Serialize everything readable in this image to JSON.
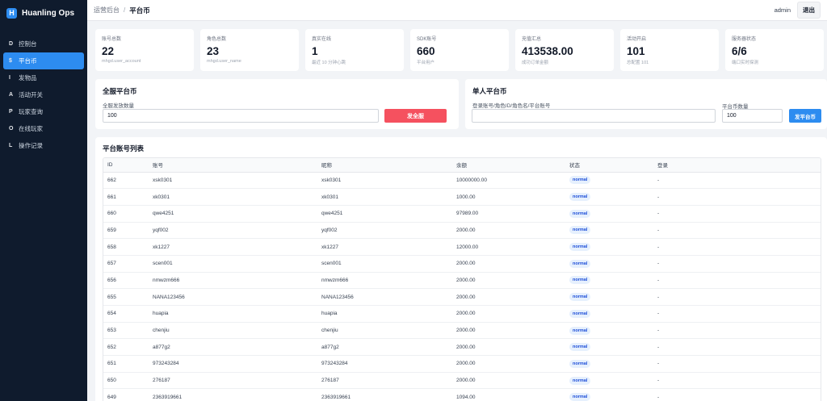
{
  "brand": {
    "logo": "H",
    "name": "Huanling Ops"
  },
  "sidebar": {
    "items": [
      {
        "key": "D",
        "label": "控制台"
      },
      {
        "key": "$",
        "label": "平台币",
        "active": true
      },
      {
        "key": "I",
        "label": "发物品"
      },
      {
        "key": "A",
        "label": "活动开关"
      },
      {
        "key": "P",
        "label": "玩家查询"
      },
      {
        "key": "O",
        "label": "在线玩家"
      },
      {
        "key": "L",
        "label": "操作记录"
      }
    ]
  },
  "header": {
    "crumb_root": "运营后台",
    "crumb_sep": "/",
    "crumb_current": "平台币",
    "user": "admin",
    "logout": "退出"
  },
  "stats": [
    {
      "label": "账号总数",
      "value": "22",
      "sub": "mhgd.user_account"
    },
    {
      "label": "角色总数",
      "value": "23",
      "sub": "mhgd.user_name"
    },
    {
      "label": "真实在线",
      "value": "1",
      "sub": "最近 10 分钟心跳"
    },
    {
      "label": "SDK账号",
      "value": "660",
      "sub": "平台用户"
    },
    {
      "label": "充值汇总",
      "value": "413538.00",
      "sub": "成功订单金额"
    },
    {
      "label": "活动开启",
      "value": "101",
      "sub": "总配置 101"
    },
    {
      "label": "服务器状态",
      "value": "6/6",
      "sub": "端口实时探测"
    }
  ],
  "all_coin": {
    "title": "全服平台币",
    "field_label": "全服发放数量",
    "amount": "100",
    "button": "发全服"
  },
  "single_coin": {
    "title": "单人平台币",
    "target_label": "登录账号/角色ID/角色名/平台账号",
    "target_value": "",
    "amount_label": "平台币数量",
    "amount": "100",
    "button": "发平台币"
  },
  "table": {
    "title": "平台账号列表",
    "columns": [
      "ID",
      "账号",
      "昵称",
      "余额",
      "状态",
      "登录"
    ],
    "rows": [
      [
        "662",
        "xsk0301",
        "xsk0301",
        "10000000.00",
        "normal",
        "-"
      ],
      [
        "661",
        "xk0301",
        "xk0301",
        "1000.00",
        "normal",
        "-"
      ],
      [
        "660",
        "qwe4251",
        "qwe4251",
        "97989.00",
        "normal",
        "-"
      ],
      [
        "659",
        "yqf002",
        "yqf002",
        "2000.00",
        "normal",
        "-"
      ],
      [
        "658",
        "xk1227",
        "xk1227",
        "12000.00",
        "normal",
        "-"
      ],
      [
        "657",
        "scen001",
        "scen001",
        "2000.00",
        "normal",
        "-"
      ],
      [
        "656",
        "nmwzm666",
        "nmwzm666",
        "2000.00",
        "normal",
        "-"
      ],
      [
        "655",
        "NANA123456",
        "NANA123456",
        "2000.00",
        "normal",
        "-"
      ],
      [
        "654",
        "huapia",
        "huapia",
        "2000.00",
        "normal",
        "-"
      ],
      [
        "653",
        "chenjiu",
        "chenjiu",
        "2000.00",
        "normal",
        "-"
      ],
      [
        "652",
        "a877g2",
        "a877g2",
        "2000.00",
        "normal",
        "-"
      ],
      [
        "651",
        "973243284",
        "973243284",
        "2000.00",
        "normal",
        "-"
      ],
      [
        "650",
        "276187",
        "276187",
        "2000.00",
        "normal",
        "-"
      ],
      [
        "649",
        "2363919661",
        "2363919661",
        "1094.00",
        "normal",
        "-"
      ]
    ]
  }
}
